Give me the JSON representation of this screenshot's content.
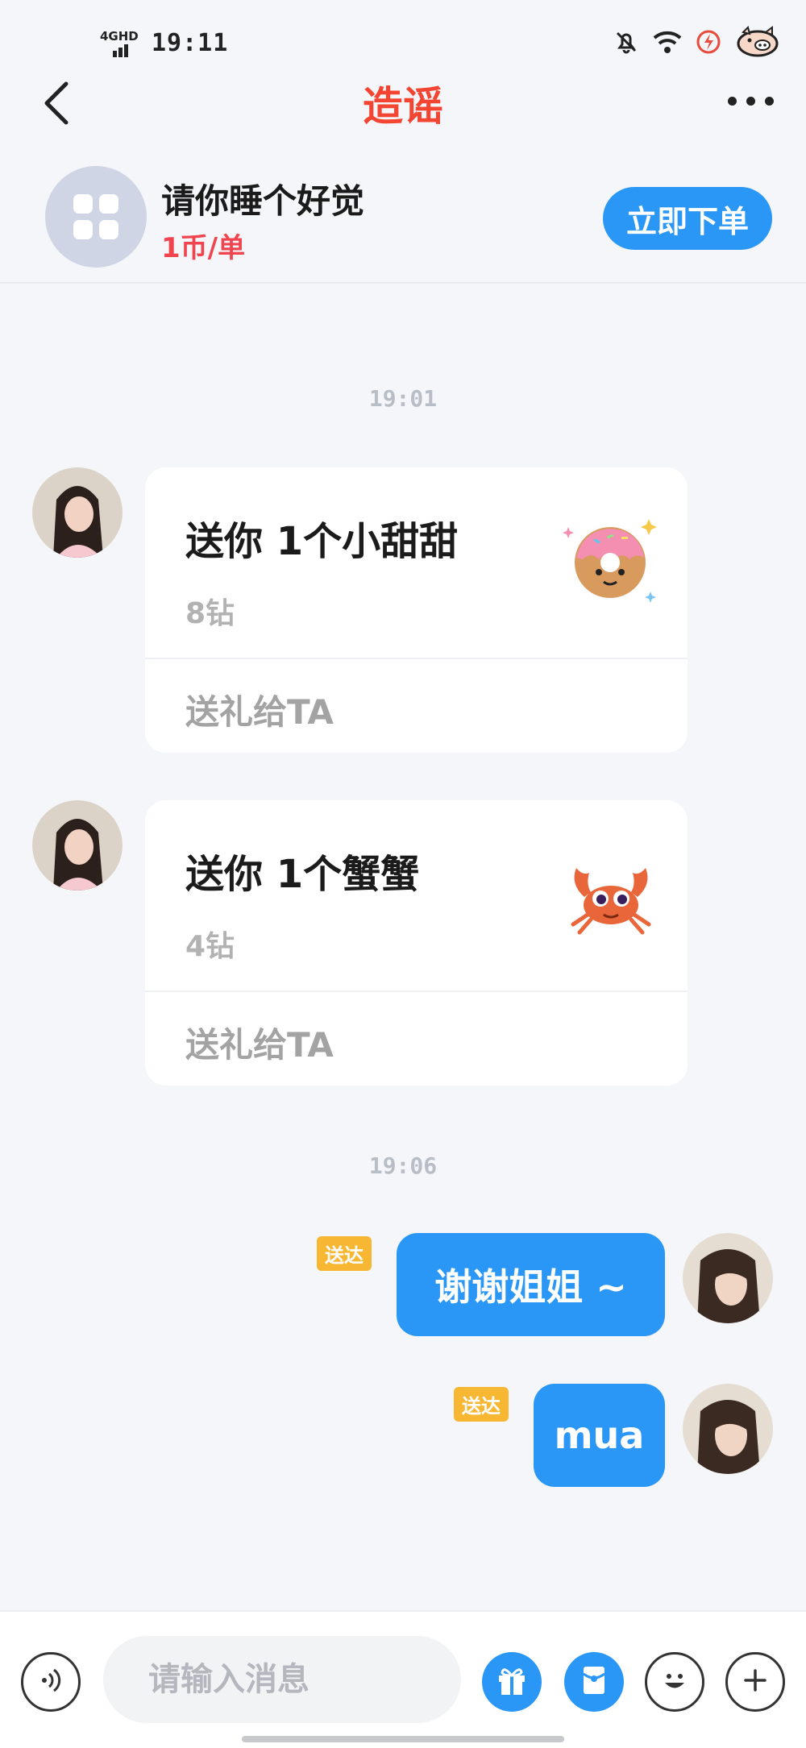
{
  "status": {
    "network": "4GHD",
    "time": "19:11"
  },
  "header": {
    "title": "造谣"
  },
  "order": {
    "service_title": "请你睡个好觉",
    "price": "1币/单",
    "button_label": "立即下单"
  },
  "chat": {
    "time_1": "19:01",
    "time_2": "19:06",
    "gifts": [
      {
        "title": "送你 1个小甜甜",
        "price": "8钻",
        "action": "送礼给TA",
        "art": "donut"
      },
      {
        "title": "送你 1个蟹蟹",
        "price": "4钻",
        "action": "送礼给TA",
        "art": "crab"
      }
    ],
    "messages": [
      {
        "tag": "送达",
        "text": "谢谢姐姐 ~"
      },
      {
        "tag": "送达",
        "text": "mua"
      }
    ]
  },
  "input": {
    "placeholder": "请输入消息"
  },
  "colors": {
    "accent": "#2a96f6",
    "title_red": "#f44533",
    "price_red": "#f0454f",
    "tag_yellow": "#f7b733"
  }
}
